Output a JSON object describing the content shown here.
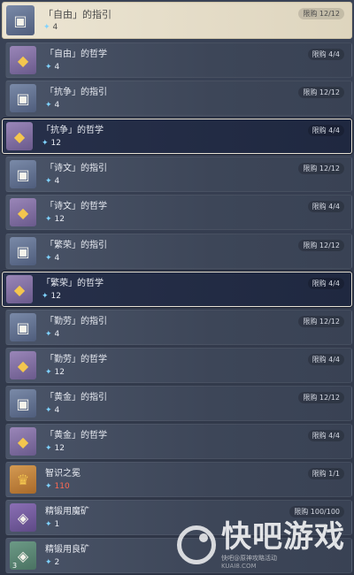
{
  "header": {
    "title": "「自由」的指引",
    "cost": "4",
    "limit": "限购 12/12"
  },
  "items": [
    {
      "name": "「自由」的哲学",
      "cost": "4",
      "limit": "限购 4/4",
      "icon": "philosophy-book-icon",
      "tone": "gold"
    },
    {
      "name": "「抗争」的指引",
      "cost": "4",
      "limit": "限购 12/12",
      "icon": "guide-book-icon",
      "tone": "silver"
    },
    {
      "name": "「抗争」的哲学",
      "cost": "12",
      "limit": "限购 4/4",
      "icon": "philosophy-book-icon",
      "tone": "gold",
      "selected": true
    },
    {
      "name": "「诗文」的指引",
      "cost": "4",
      "limit": "限购 12/12",
      "icon": "guide-book-icon",
      "tone": "silver"
    },
    {
      "name": "「诗文」的哲学",
      "cost": "12",
      "limit": "限购 4/4",
      "icon": "philosophy-book-icon",
      "tone": "gold"
    },
    {
      "name": "「繁荣」的指引",
      "cost": "4",
      "limit": "限购 12/12",
      "icon": "guide-book-icon",
      "tone": "silver"
    },
    {
      "name": "「繁荣」的哲学",
      "cost": "12",
      "limit": "限购 4/4",
      "icon": "philosophy-book-icon",
      "tone": "gold",
      "selected": true
    },
    {
      "name": "「勤劳」的指引",
      "cost": "4",
      "limit": "限购 12/12",
      "icon": "guide-book-icon",
      "tone": "silver"
    },
    {
      "name": "「勤劳」的哲学",
      "cost": "12",
      "limit": "限购 4/4",
      "icon": "philosophy-book-icon",
      "tone": "gold"
    },
    {
      "name": "「黄金」的指引",
      "cost": "4",
      "limit": "限购 12/12",
      "icon": "guide-book-icon",
      "tone": "silver"
    },
    {
      "name": "「黄金」的哲学",
      "cost": "12",
      "limit": "限购 4/4",
      "icon": "philosophy-book-icon",
      "tone": "gold"
    },
    {
      "name": "智识之冕",
      "cost": "110",
      "limit": "限购 1/1",
      "icon": "crown-icon",
      "tone": "orange",
      "cost_red": true
    },
    {
      "name": "精锻用魔矿",
      "cost": "1",
      "limit": "限购 100/100",
      "icon": "ore-crystal-icon",
      "tone": "purple",
      "corner": ""
    },
    {
      "name": "精锻用良矿",
      "cost": "2",
      "limit": "",
      "icon": "ore-crystal-icon",
      "tone": "green",
      "corner": "3"
    }
  ],
  "watermark": {
    "brand": "快吧游戏",
    "sub": "快吧@原神攻略活动",
    "url": "KUAI8.COM"
  },
  "colors": {
    "gem": "#7fd3ff",
    "cost_red": "#ff6a52",
    "star": "#ffd75e"
  }
}
